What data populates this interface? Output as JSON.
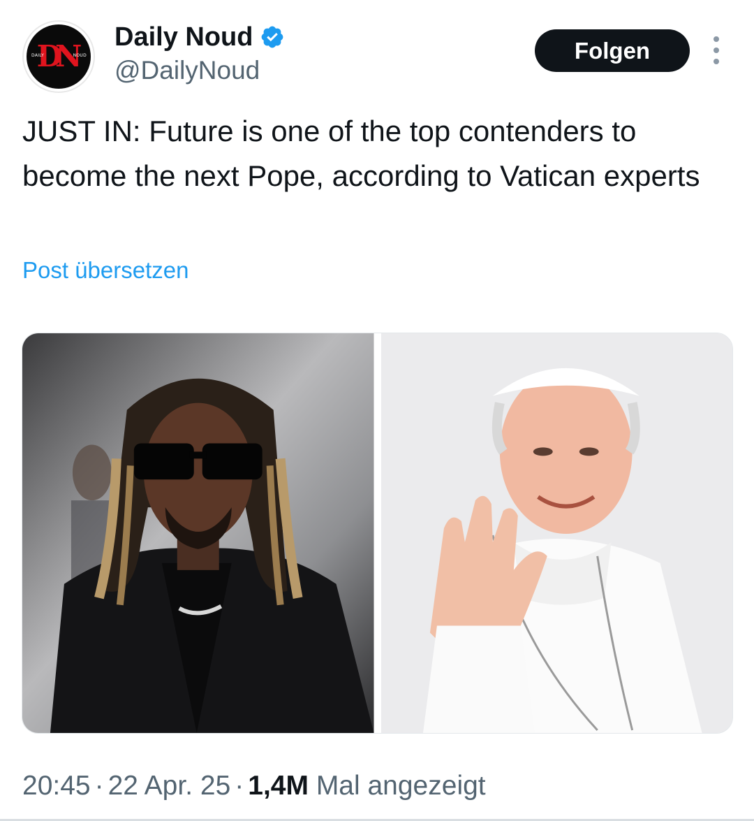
{
  "author": {
    "display_name": "Daily Noud",
    "handle": "@DailyNoud",
    "verified": true,
    "avatar": {
      "logo_text": "DN",
      "left_text": "DAILY",
      "right_text": "NOUD",
      "background": "#0a0a0a",
      "logo_color": "#e0141e"
    }
  },
  "header": {
    "follow_label": "Folgen",
    "more_icon": "more-vertical-icon"
  },
  "tweet": {
    "text": "JUST IN: Future is one of the top contenders to become the next Pope, according to Vatican experts",
    "translate_label": "Post übersetzen"
  },
  "media": [
    {
      "name": "photo-future",
      "icon": "photo"
    },
    {
      "name": "photo-pope",
      "icon": "photo"
    }
  ],
  "meta": {
    "time": "20:45",
    "date": "22 Apr. 25",
    "separator": "·",
    "views": "1,4M",
    "views_label": "Mal angezeigt"
  },
  "colors": {
    "accent": "#1d9bf0",
    "text_primary": "#0f1419",
    "text_secondary": "#536471",
    "button_bg": "#0f1419"
  }
}
